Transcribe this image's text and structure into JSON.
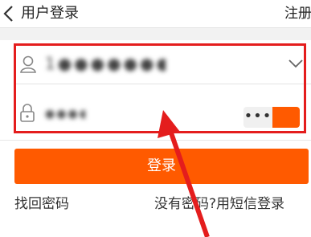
{
  "header": {
    "title": "用户登录",
    "register_label": "注册",
    "back_icon": "chevron-left-icon"
  },
  "form": {
    "account_value": "1●●●●●●●●●",
    "account_icon": "user-icon",
    "dropdown_icon": "chevron-down-icon",
    "password_value": "●●●●",
    "password_icon": "lock-icon",
    "password_toggle_dots": "•••"
  },
  "login_button_label": "登录",
  "links": {
    "forgot_password": "找回密码",
    "sms_login": "没有密码?用短信登录"
  },
  "colors": {
    "accent": "#ff5a00",
    "annotation": "#e41d1d"
  }
}
